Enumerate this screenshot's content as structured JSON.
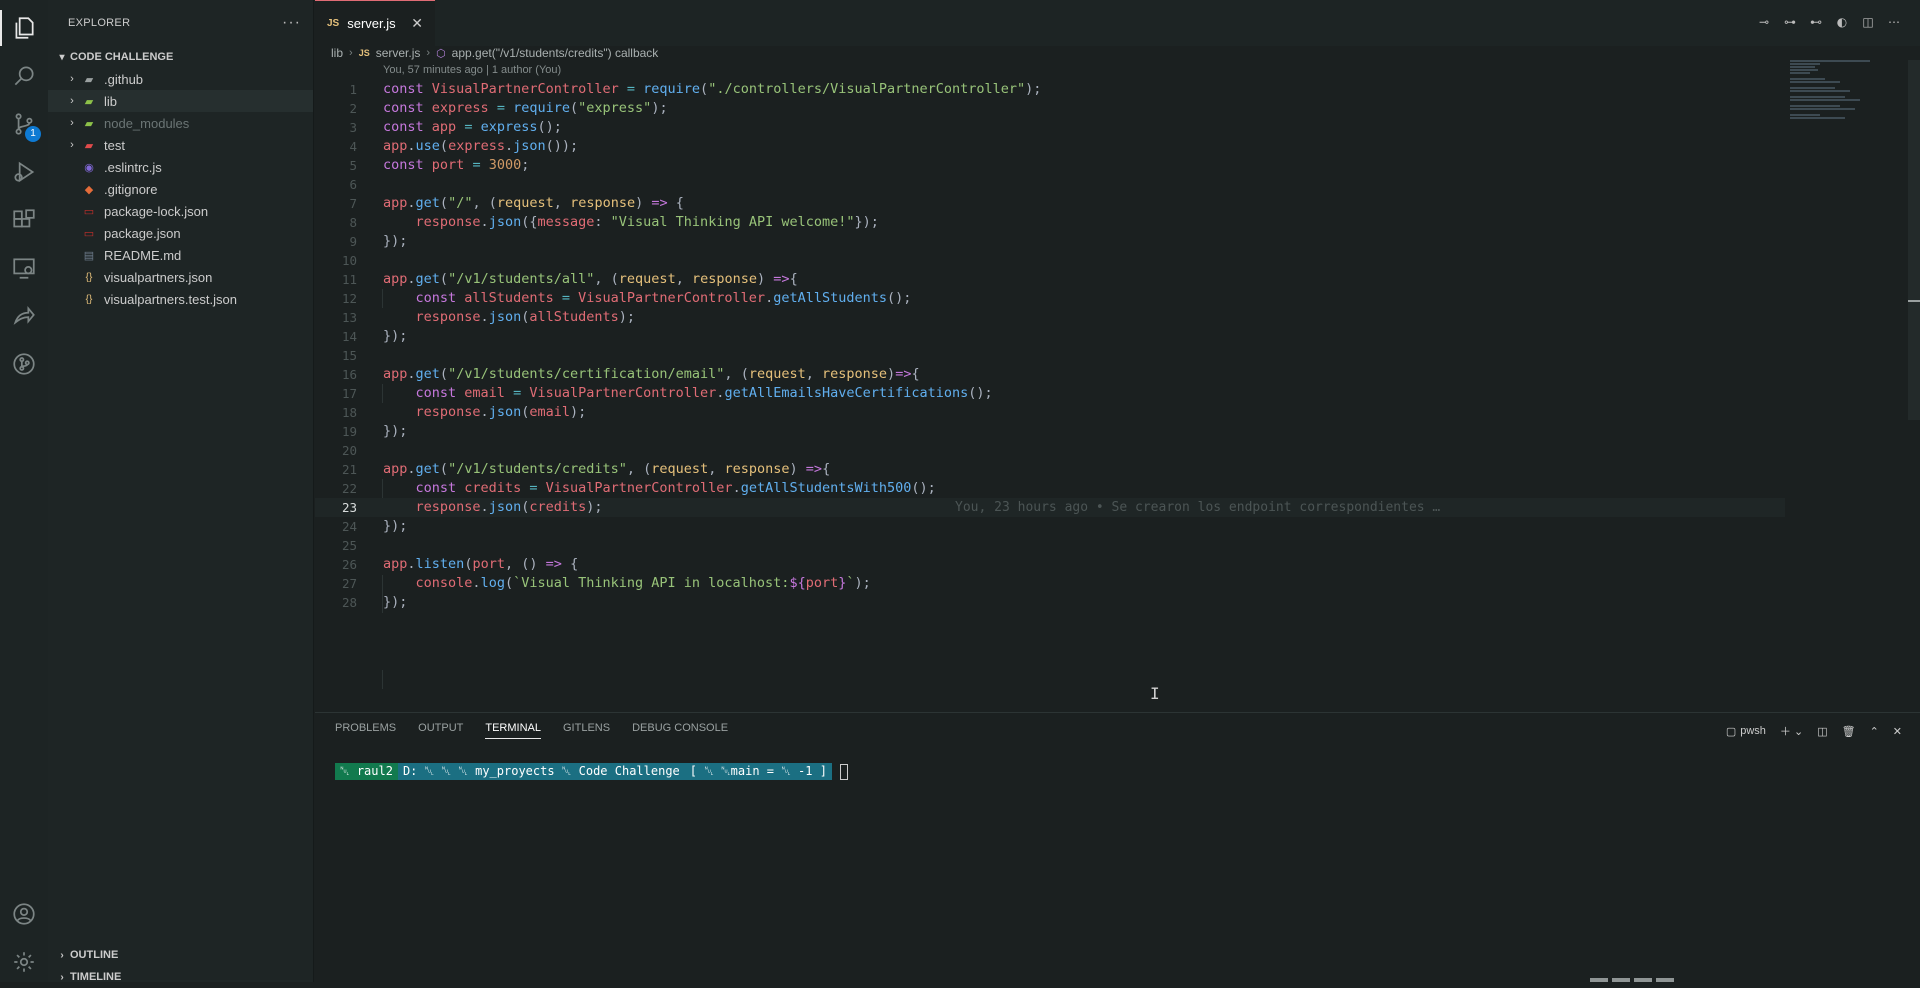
{
  "explorer": {
    "title": "EXPLORER",
    "more": "···",
    "project": "CODE CHALLENGE",
    "items": [
      {
        "label": ".github",
        "folder": true,
        "icon": "github-folder-icon",
        "color": "#9aa0a0"
      },
      {
        "label": "lib",
        "folder": true,
        "icon": "lib-folder-icon",
        "color": "#8dc149"
      },
      {
        "label": "node_modules",
        "folder": true,
        "icon": "node-modules-folder-icon",
        "color": "#8dc149",
        "dim": true
      },
      {
        "label": "test",
        "folder": true,
        "icon": "test-folder-icon",
        "color": "#e04b4b"
      },
      {
        "label": ".eslintrc.js",
        "folder": false,
        "icon": "eslint-icon",
        "color": "#8067d6"
      },
      {
        "label": ".gitignore",
        "folder": false,
        "icon": "git-icon",
        "color": "#e46c3a"
      },
      {
        "label": "package-lock.json",
        "folder": false,
        "icon": "npm-icon",
        "color": "#c9302c"
      },
      {
        "label": "package.json",
        "folder": false,
        "icon": "npm-icon",
        "color": "#c9302c"
      },
      {
        "label": "README.md",
        "folder": false,
        "icon": "markdown-icon",
        "color": "#6e7c8c"
      },
      {
        "label": "visualpartners.json",
        "folder": false,
        "icon": "json-icon",
        "color": "#e5c07b"
      },
      {
        "label": "visualpartners.test.json",
        "folder": false,
        "icon": "json-icon",
        "color": "#e5c07b"
      }
    ],
    "outline": "OUTLINE",
    "timeline": "TIMELINE"
  },
  "activity": {
    "scm_badge": "1"
  },
  "tab": {
    "badge": "JS",
    "label": "server.js",
    "close": "✕"
  },
  "breadcrumb": {
    "folder": "lib",
    "file_badge": "JS",
    "file": "server.js",
    "symbol": "app.get(\"/v1/students/credits\") callback"
  },
  "codelens": "You, 57 minutes ago | 1 author (You)",
  "editor": {
    "current_line": 23,
    "blame": "You, 23 hours ago • Se crearon los endpoint correspondientes …"
  },
  "panel": {
    "tabs": [
      "PROBLEMS",
      "OUTPUT",
      "TERMINAL",
      "GITLENS",
      "DEBUG CONSOLE"
    ],
    "active_tab": "TERMINAL",
    "shell": "pwsh",
    "prompt": {
      "user": "␀ raul2",
      "path": "D: ␀ ␀ ␀ my_proyects ␀ Code Challenge",
      "git": "[ ␀ ␀main = ␀ -1 ]"
    }
  }
}
